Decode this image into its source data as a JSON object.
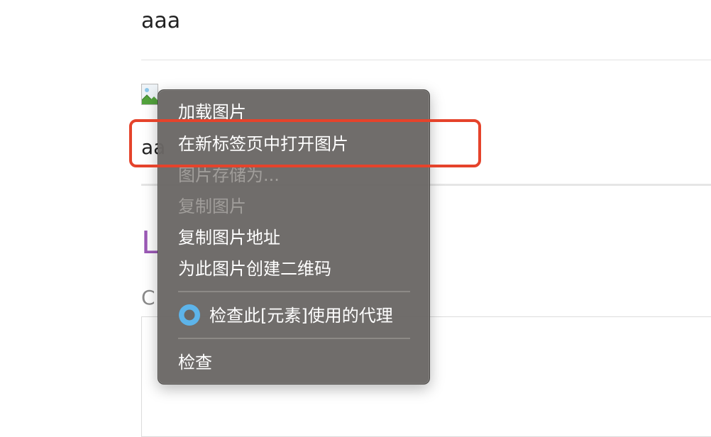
{
  "page": {
    "text_top": "aaa",
    "text_mid": "aa",
    "heading_partial": "L",
    "sub_partial": "C"
  },
  "context_menu": {
    "items": [
      {
        "label": "加载图片",
        "enabled": true
      },
      {
        "label": "在新标签页中打开图片",
        "enabled": true
      },
      {
        "label": "图片存储为...",
        "enabled": false
      },
      {
        "label": "复制图片",
        "enabled": false
      },
      {
        "label": "复制图片地址",
        "enabled": true
      },
      {
        "label": "为此图片创建二维码",
        "enabled": true
      },
      {
        "label": "检查此[元素]使用的代理",
        "enabled": true,
        "icon": "proxy-extension-icon"
      },
      {
        "label": "检查",
        "enabled": true
      }
    ]
  },
  "colors": {
    "highlight_border": "#e5432b",
    "menu_background": "#6a6765",
    "heading_accent": "#9b59b6",
    "extension_icon": "#5db4ea"
  }
}
